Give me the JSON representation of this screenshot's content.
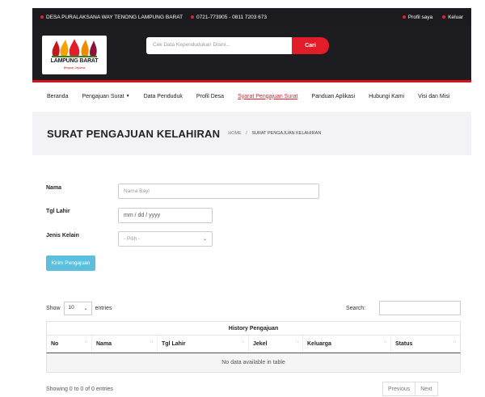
{
  "topbar": {
    "address": "DESA PURALAKSANA WAY TENONG LAMPUNG BARAT",
    "phone": "0721-773905 - 0811 7203 673",
    "profile": "Profil saya",
    "logout": "Keluar"
  },
  "header": {
    "logo_name": "LAMPUNG BARAT",
    "logo_tagline": "Beguai Jejama",
    "search_placeholder": "Cek Data Kependudukan Disini...",
    "search_button": "Cari"
  },
  "nav": {
    "items": [
      {
        "label": "Beranda"
      },
      {
        "label": "Pengajuan Surat"
      },
      {
        "label": "Data Penduduk"
      },
      {
        "label": "Profil Desa"
      },
      {
        "label": "Syarat Pengajuan Surat"
      },
      {
        "label": "Panduan Aplikasi"
      },
      {
        "label": "Hubungi Kami"
      },
      {
        "label": "Visi dan Misi"
      }
    ],
    "active_index": 4
  },
  "banner": {
    "title": "SURAT PENGAJUAN KELAHIRAN",
    "breadcrumb_home": "HOME",
    "breadcrumb_separator": "/",
    "breadcrumb_current": "SURAT PENGAJUAN KELAHIRAN"
  },
  "form": {
    "name_label": "Nama",
    "name_placeholder": "Nama Bayi",
    "dob_label": "Tgl Lahir",
    "dob_value": "mm / dd / yyyy",
    "gender_label": "Jenis Kelain",
    "gender_value": "- Pilih -",
    "submit_label": "Kirim Pengajuan"
  },
  "table": {
    "show_label": "Show",
    "entries_value": "10",
    "entries_label": "entries",
    "search_label": "Search:",
    "caption": "History Pengajuan",
    "columns": [
      "No",
      "Nama",
      "Tgl Lahir",
      "Jekel",
      "Keluarga",
      "Status"
    ],
    "empty_text": "No data available in table",
    "info": "Showing 0 to 0 of 0 entries",
    "prev": "Previous",
    "next": "Next"
  },
  "colors": {
    "accent": "#e11d2a",
    "header_bg": "#1d1d21",
    "button_info": "#5bc0de"
  }
}
